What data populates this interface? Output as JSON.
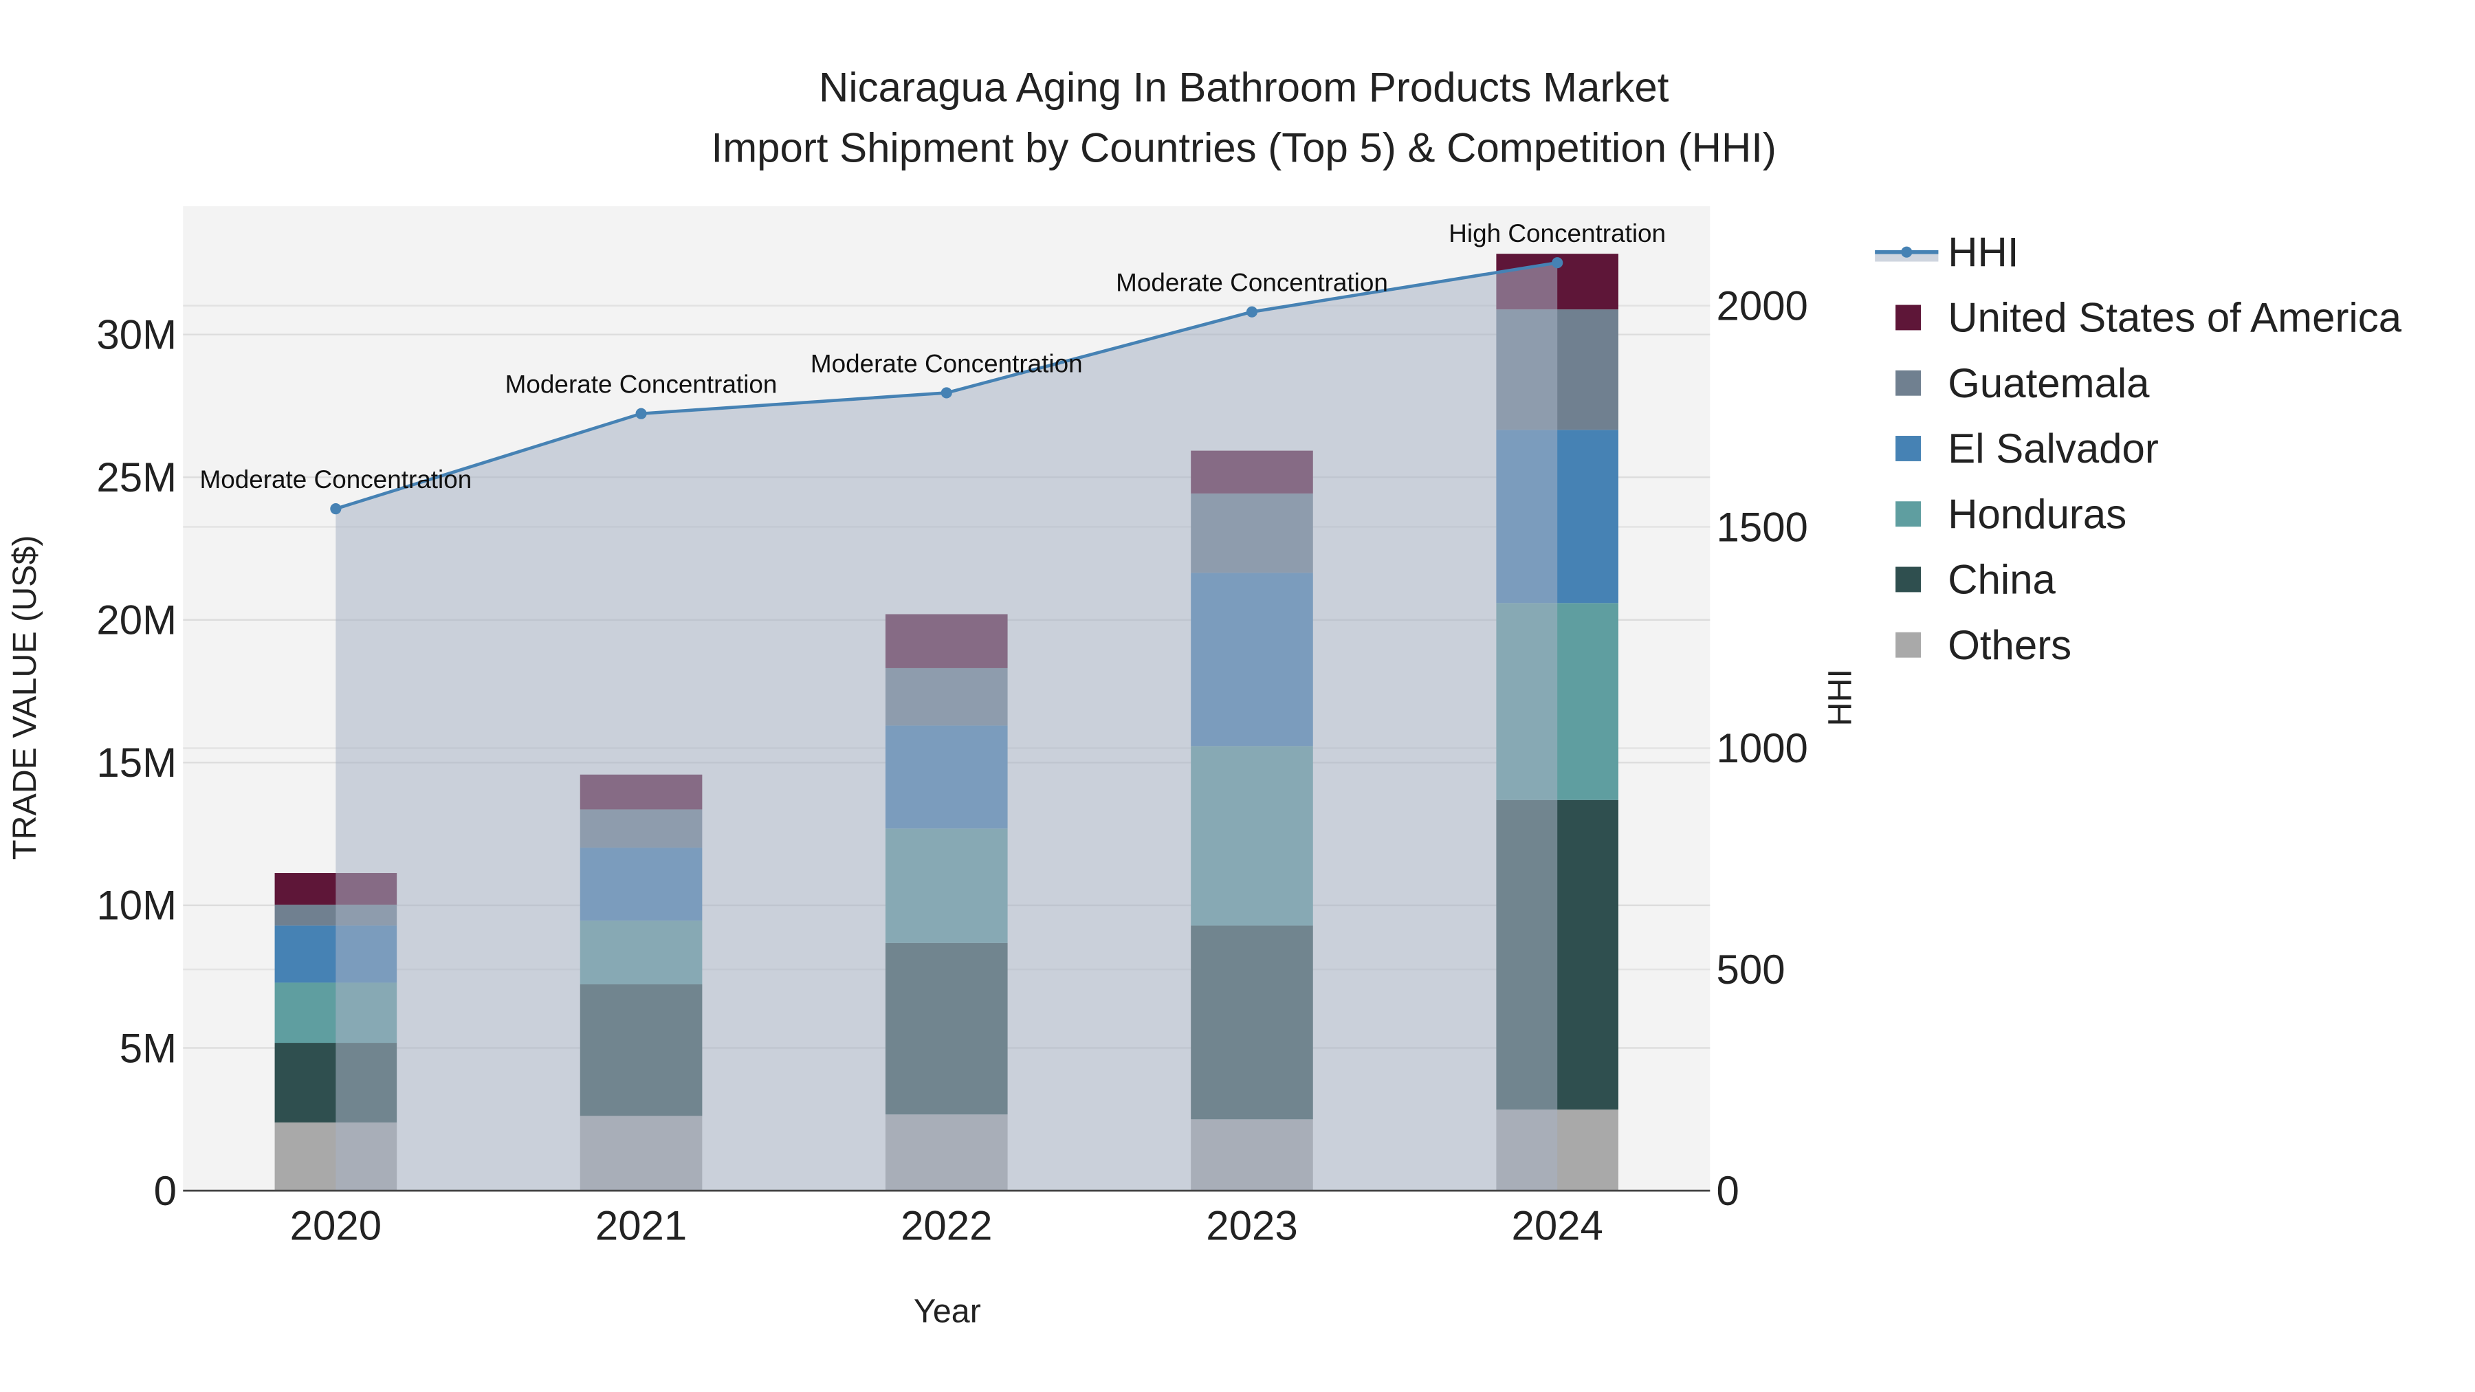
{
  "chart_data": {
    "type": "bar",
    "stacked": true,
    "title": "Nicaragua Aging In Bathroom Products Market",
    "subtitle": "Import Shipment by Countries (Top 5) & Competition (HHI)",
    "xlabel": "Year",
    "ylabel": "TRADE VALUE (US$)",
    "y2label": "HHI",
    "categories": [
      "2020",
      "2021",
      "2022",
      "2023",
      "2024"
    ],
    "ylim": [
      0,
      34500000
    ],
    "y2lim": [
      0,
      2225
    ],
    "yticks": [
      {
        "v": 0,
        "label": "0"
      },
      {
        "v": 5000000,
        "label": "5M"
      },
      {
        "v": 10000000,
        "label": "10M"
      },
      {
        "v": 15000000,
        "label": "15M"
      },
      {
        "v": 20000000,
        "label": "20M"
      },
      {
        "v": 25000000,
        "label": "25M"
      },
      {
        "v": 30000000,
        "label": "30M"
      }
    ],
    "y2ticks": [
      {
        "v": 0,
        "label": "0"
      },
      {
        "v": 500,
        "label": "500"
      },
      {
        "v": 1000,
        "label": "1000"
      },
      {
        "v": 1500,
        "label": "1500"
      },
      {
        "v": 2000,
        "label": "2000"
      }
    ],
    "series": [
      {
        "name": "Others",
        "color": "#a9a9a9",
        "values": [
          2390000,
          2620000,
          2670000,
          2500000,
          2840000
        ]
      },
      {
        "name": "China",
        "color": "#2f4f4f",
        "values": [
          2790000,
          4610000,
          6010000,
          6790000,
          10850000
        ]
      },
      {
        "name": "Honduras",
        "color": "#5f9ea0",
        "values": [
          2110000,
          2230000,
          4010000,
          6290000,
          6900000
        ]
      },
      {
        "name": "El Salvador",
        "color": "#4682b4",
        "values": [
          2000000,
          2560000,
          3610000,
          6070000,
          6070000
        ]
      },
      {
        "name": "Guatemala",
        "color": "#708090",
        "values": [
          730000,
          1340000,
          2010000,
          2780000,
          4220000
        ]
      },
      {
        "name": "United States of America",
        "color": "#5e1638",
        "values": [
          1110000,
          1220000,
          1890000,
          1500000,
          1950000
        ]
      }
    ],
    "hhi": {
      "name": "HHI",
      "color": "#4682b4",
      "values": [
        1541,
        1756,
        1803,
        1986,
        2097
      ],
      "annotations": [
        "Moderate Concentration",
        "Moderate Concentration",
        "Moderate Concentration",
        "Moderate Concentration",
        "High Concentration"
      ]
    },
    "legend_order": [
      "HHI",
      "United States of America",
      "Guatemala",
      "El Salvador",
      "Honduras",
      "China",
      "Others"
    ],
    "legend_placement": "right",
    "grid": true
  }
}
